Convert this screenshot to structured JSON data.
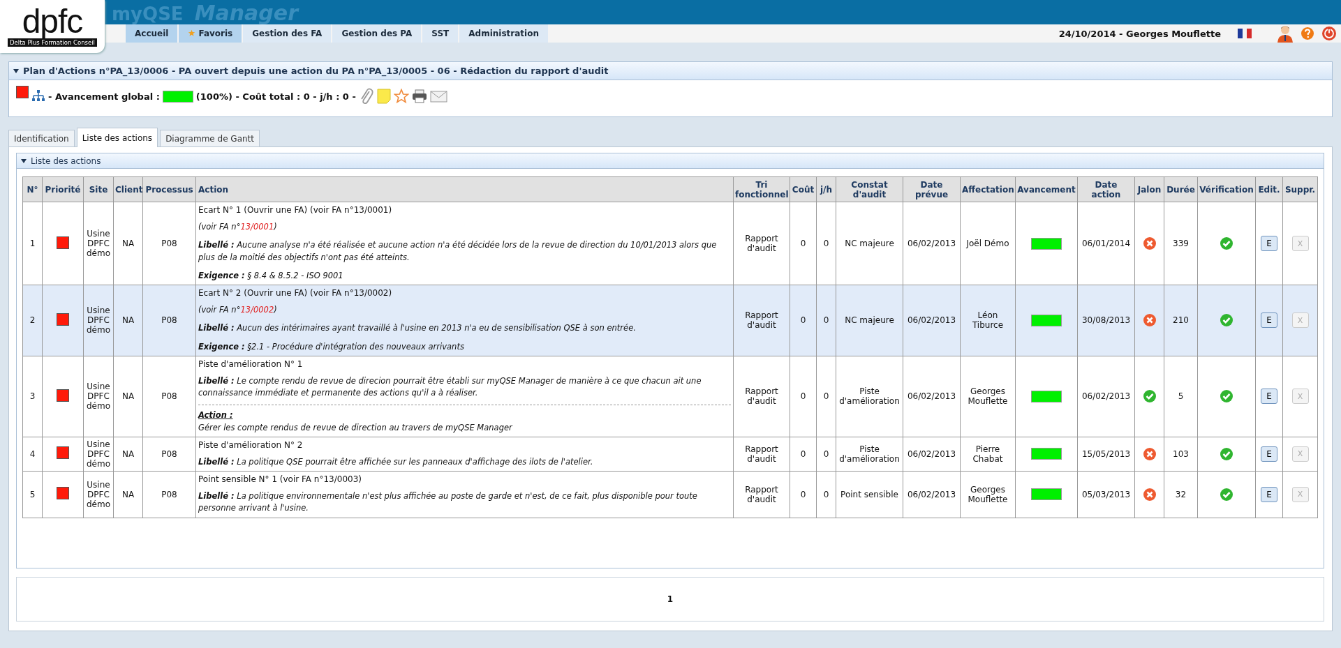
{
  "header": {
    "logo": {
      "mark": "dpfc",
      "tagline": "Delta Plus Formation Conseil"
    },
    "banner": [
      "myQSE",
      "Manager"
    ],
    "nav": [
      {
        "label": "Accueil",
        "selected": true,
        "starred": false
      },
      {
        "label": "Favoris",
        "selected": true,
        "starred": true
      },
      {
        "label": "Gestion des FA",
        "selected": false,
        "starred": false
      },
      {
        "label": "Gestion des PA",
        "selected": false,
        "starred": false
      },
      {
        "label": "SST",
        "selected": false,
        "starred": false
      },
      {
        "label": "Administration",
        "selected": false,
        "starred": false
      }
    ],
    "user_line": "24/10/2014 - Georges Mouflette"
  },
  "plan": {
    "title": "Plan d'Actions n°PA_13/0006 - PA ouvert depuis une action du PA n°PA_13/0005 - 06 - Rédaction du rapport d'audit",
    "expanded": true,
    "progress_label": "- Avancement global :",
    "level": 1,
    "summary": "(100%) - Coût total : 0 - j/h : 0 -"
  },
  "tabs": [
    {
      "label": "Identification",
      "selected": false
    },
    {
      "label": "Liste des actions",
      "selected": true
    },
    {
      "label": "Diagramme de Gantt",
      "selected": false
    }
  ],
  "actions_panel": {
    "title": "Liste des actions",
    "expanded": true
  },
  "table": {
    "columns": [
      "N°",
      "Priorité",
      "Site",
      "Client",
      "Processus",
      "Action",
      "Tri fonctionnel",
      "Coût",
      "j/h",
      "Constat d'audit",
      "Date prévue",
      "Affectation",
      "Avancement",
      "Date action",
      "Jalon",
      "Durée",
      "Vérification",
      "Edit.",
      "Suppr."
    ],
    "rows": [
      {
        "selected": false,
        "no": "1",
        "site": "Usine DPFC démo",
        "client": "NA",
        "process": "P08",
        "title": "Ecart N° 1 (Ouvrir une FA) (voir FA n°13/0001)",
        "paragraphs": [
          {
            "kind": "ref",
            "text": "(voir FA n°",
            "link": "13/0001",
            "end": ")"
          },
          {
            "kind": "note",
            "text": "**Libellé :** Aucune analyse n'a été réalisée et aucune action n'a été décidée lors de la revue de direction du 10/01/2013 alors que plus de la moitié des objectifs n'ont pas été atteints."
          },
          {
            "kind": "note",
            "text": "**Exigence :** § 8.4 & 8.5.2 -  ISO 9001"
          }
        ],
        "tri": "Rapport d'audit",
        "cost": "0",
        "jh": "0",
        "finding": "NC majeure",
        "planned": "06/02/2013",
        "assignee": "Joël Démo",
        "level": 1,
        "action_date": "06/01/2014",
        "milestone_ok": false,
        "duration": "339",
        "verified": true,
        "edit": "E",
        "delete": {
          "label": "X",
          "disabled": true
        }
      },
      {
        "selected": true,
        "no": "2",
        "site": "Usine DPFC démo",
        "client": "NA",
        "process": "P08",
        "title": "Ecart N° 2 (Ouvrir une FA) (voir FA n°13/0002)",
        "paragraphs": [
          {
            "kind": "ref",
            "text": "(voir FA n°",
            "link": "13/0002",
            "end": ")"
          },
          {
            "kind": "note",
            "text": "**Libellé :** Aucun des intérimaires ayant travaillé à l'usine en 2013 n'a eu de sensibilisation QSE à son entrée."
          },
          {
            "kind": "note",
            "text": "**Exigence :** §2.1 - Procédure d'intégration des nouveaux arrivants"
          }
        ],
        "tri": "Rapport d'audit",
        "cost": "0",
        "jh": "0",
        "finding": "NC majeure",
        "planned": "06/02/2013",
        "assignee": "Léon Tiburce",
        "level": 1,
        "action_date": "30/08/2013",
        "milestone_ok": false,
        "duration": "210",
        "verified": true,
        "edit": "E",
        "delete": {
          "label": "X",
          "disabled": true
        }
      },
      {
        "selected": false,
        "no": "3",
        "site": "Usine DPFC démo",
        "client": "NA",
        "process": "P08",
        "title": "Piste d'amélioration N° 1",
        "paragraphs": [
          {
            "kind": "note",
            "text": "**Libellé :** Le compte rendu de revue de direcion pourrait être établi sur myQSE Manager de manière à ce que chacun ait une connaissance immédiate et permanente des actions qu'il a à réaliser."
          },
          {
            "kind": "action",
            "label": "Action :",
            "text": "Gérer les compte rendus de revue de direction au travers de myQSE Manager"
          }
        ],
        "tri": "Rapport d'audit",
        "cost": "0",
        "jh": "0",
        "finding": "Piste d'amélioration",
        "planned": "06/02/2013",
        "assignee": "Georges Mouflette",
        "level": 1,
        "action_date": "06/02/2013",
        "milestone_ok": true,
        "duration": "5",
        "verified": true,
        "edit": "E",
        "delete": {
          "label": "X",
          "disabled": true
        }
      },
      {
        "selected": false,
        "no": "4",
        "site": "Usine DPFC démo",
        "client": "NA",
        "process": "P08",
        "title": "Piste d'amélioration N° 2",
        "paragraphs": [
          {
            "kind": "note",
            "text": "**Libellé :** La politique QSE pourrait être affichée sur les panneaux d'affichage des ilots de l'atelier."
          }
        ],
        "tri": "Rapport d'audit",
        "cost": "0",
        "jh": "0",
        "finding": "Piste d'amélioration",
        "planned": "06/02/2013",
        "assignee": "Pierre Chabat",
        "level": 1,
        "action_date": "15/05/2013",
        "milestone_ok": false,
        "duration": "103",
        "verified": true,
        "edit": "E",
        "delete": {
          "label": "X",
          "disabled": true
        }
      },
      {
        "selected": false,
        "no": "5",
        "site": "Usine DPFC démo",
        "client": "NA",
        "process": "P08",
        "title": "Point sensible N° 1 (voir FA n°13/0003)",
        "paragraphs": [
          {
            "kind": "note",
            "text": "**Libellé :** La politique environnementale n'est plus affichée au poste de garde et n'est, de ce fait, plus disponible pour toute personne arrivant à l'usine."
          }
        ],
        "tri": "Rapport d'audit",
        "cost": "0",
        "jh": "0",
        "finding": "Point sensible",
        "planned": "06/02/2013",
        "assignee": "Georges Mouflette",
        "level": 1,
        "action_date": "05/03/2013",
        "milestone_ok": false,
        "duration": "32",
        "verified": true,
        "edit": "E",
        "delete": {
          "label": "X",
          "disabled": true
        }
      }
    ]
  },
  "pagination": {
    "pages": [
      {
        "label": "1",
        "selected": true
      }
    ]
  }
}
